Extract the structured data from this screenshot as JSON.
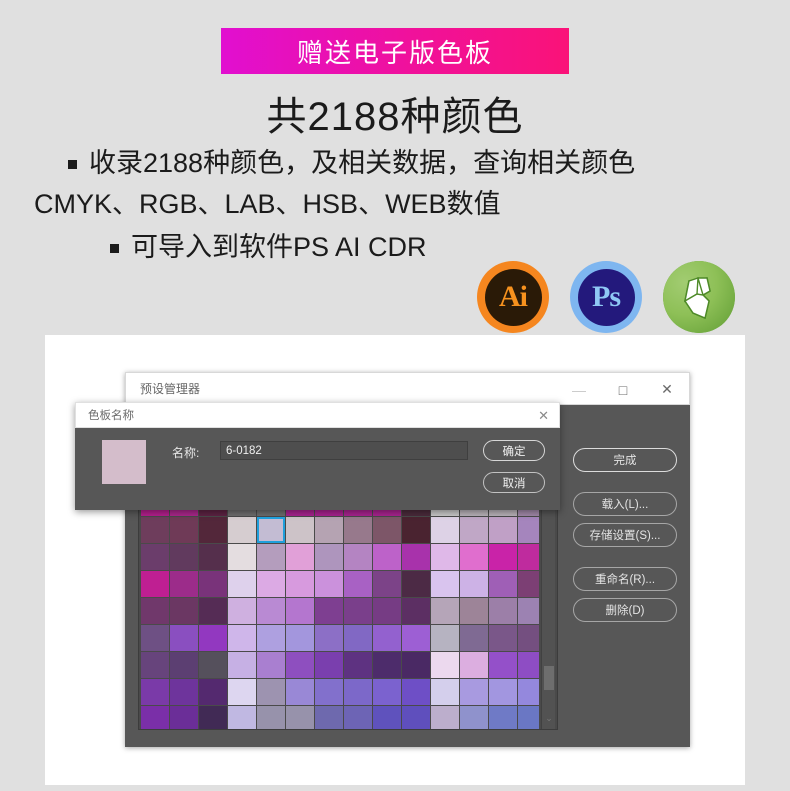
{
  "promo": {
    "banner_text": "赠送电子版色板",
    "headline": "共2188种颜色",
    "bullets": [
      "收录2188种颜色，及相关数据，查询相关颜色",
      "CMYK、RGB、LAB、HSB、WEB数值",
      "可导入到软件PS AI CDR"
    ],
    "banner_gradient_start": "#e10fd0",
    "banner_gradient_end": "#fa1278"
  },
  "app_icons": [
    {
      "name": "illustrator-icon",
      "label": "Ai",
      "ring_color": "#f5861f",
      "body_color": "#2a1a07",
      "text_color": "#f7921e"
    },
    {
      "name": "photoshop-icon",
      "label": "Ps",
      "ring_color": "#7eb6f0",
      "body_color": "#23197c",
      "text_color": "#8fc8f5"
    },
    {
      "name": "coreldraw-icon",
      "label": "",
      "ring_color": "#6aa83c",
      "body_color": "#8ec057",
      "text_color": "#ffffff"
    }
  ],
  "preset_manager": {
    "title": "预设管理器",
    "window_buttons": {
      "minimize": "—",
      "maximize": "□",
      "close": "✕"
    },
    "buttons": [
      {
        "label": "完成",
        "primary": true
      },
      {
        "label": "载入(L)...",
        "primary": false
      },
      {
        "label": "存储设置(S)...",
        "primary": false
      },
      {
        "label": "重命名(R)...",
        "primary": false
      },
      {
        "label": "删除(D)",
        "primary": false
      }
    ],
    "scrollbar_chevron": "⌄"
  },
  "swatch_dialog": {
    "title": "色板名称",
    "close": "✕",
    "name_label": "名称:",
    "name_value": "6-0182",
    "name_placeholder": "6-0182",
    "preview_color": "#d4bdcb",
    "ok_label": "确定",
    "cancel_label": "取消"
  },
  "swatch_grid": {
    "columns": 14,
    "selected_index": 18,
    "rows": [
      [
        "#b31f8c",
        "#a9278a",
        "#5c2342",
        "#6d6d6d",
        "#6d6d6d",
        "#a8238e",
        "#a8238e",
        "#a8238e",
        "#a8238e",
        "#4a2a3a",
        "#c9c9c9",
        "#b9b2b8",
        "#b9b2b8",
        "#a088a8"
      ],
      [
        "#6e3d5c",
        "#6f3a57",
        "#53273a",
        "#d6cdd0",
        "#c3bcd3",
        "#cdc3c8",
        "#b5a3b2",
        "#97798c",
        "#7d5668",
        "#4a2330",
        "#ddd2e6",
        "#c0a7c6",
        "#c0a0c6",
        "#a585bd"
      ],
      [
        "#6b3d6b",
        "#613a5e",
        "#552f4c",
        "#e4dde0",
        "#b49dbd",
        "#e1a0d8",
        "#ae95bd",
        "#b484c2",
        "#bd62c9",
        "#a832ab",
        "#dfb8e8",
        "#e06ece",
        "#c923a8",
        "#bf2b9e"
      ],
      [
        "#bf1f92",
        "#9c2c8a",
        "#79337a",
        "#ded1ec",
        "#dcaae4",
        "#d79ade",
        "#cb91dc",
        "#a861c4",
        "#7c4388",
        "#4c2a45",
        "#d9c4ee",
        "#cdb2e6",
        "#9f5fb6",
        "#7c3f74"
      ],
      [
        "#70386b",
        "#6b3763",
        "#552c55",
        "#cfb0e0",
        "#b98ad3",
        "#b476cf",
        "#7e3f91",
        "#7a3f8b",
        "#763c84",
        "#5c2f63",
        "#b5a5b8",
        "#9d8498",
        "#9c7fa8",
        "#9c82b2"
      ],
      [
        "#6e5084",
        "#8a4fc0",
        "#9238c0",
        "#cfb6ea",
        "#aea0e0",
        "#a396dd",
        "#8c6fc6",
        "#8168c4",
        "#9361cf",
        "#9d5fd4",
        "#b6b3c1",
        "#7f6a93",
        "#7a5789",
        "#744f80"
      ],
      [
        "#67447c",
        "#5c3f72",
        "#55505c",
        "#c6b0e4",
        "#a97fd0",
        "#8e4fbf",
        "#7a3fae",
        "#5e3281",
        "#4d2c6b",
        "#4a2964",
        "#ecd9ee",
        "#dcaee0",
        "#9450c9",
        "#8e4dc4"
      ],
      [
        "#7a3aa8",
        "#6e349c",
        "#54296f",
        "#ddd6f0",
        "#9d93b0",
        "#9988d6",
        "#8270cc",
        "#7c68c9",
        "#7b62cf",
        "#6e4fc6",
        "#d4cfec",
        "#a89ae0",
        "#a296e0",
        "#9488dd"
      ],
      [
        "#7a2fa8",
        "#6b2e98",
        "#412a55",
        "#c0b8e2",
        "#9792ab",
        "#9792ab",
        "#6e69ae",
        "#6d64b5",
        "#5f52bd",
        "#5f4fbd",
        "#bcaecc",
        "#8f92cc",
        "#6f7ac6",
        "#6a77c4"
      ],
      [
        "#5f7ec9",
        "#5f7ec9",
        "#4f3fbd",
        "#e8e8f2",
        "#9fb4e2",
        "#9fb4e2",
        "#3a3a5c",
        "#3a3a5c",
        "#3a3a5c",
        "#2b2b3f",
        "#e2e2ee",
        "#8fa4e0",
        "#6a7fd4",
        "#5c6fcc"
      ]
    ]
  }
}
